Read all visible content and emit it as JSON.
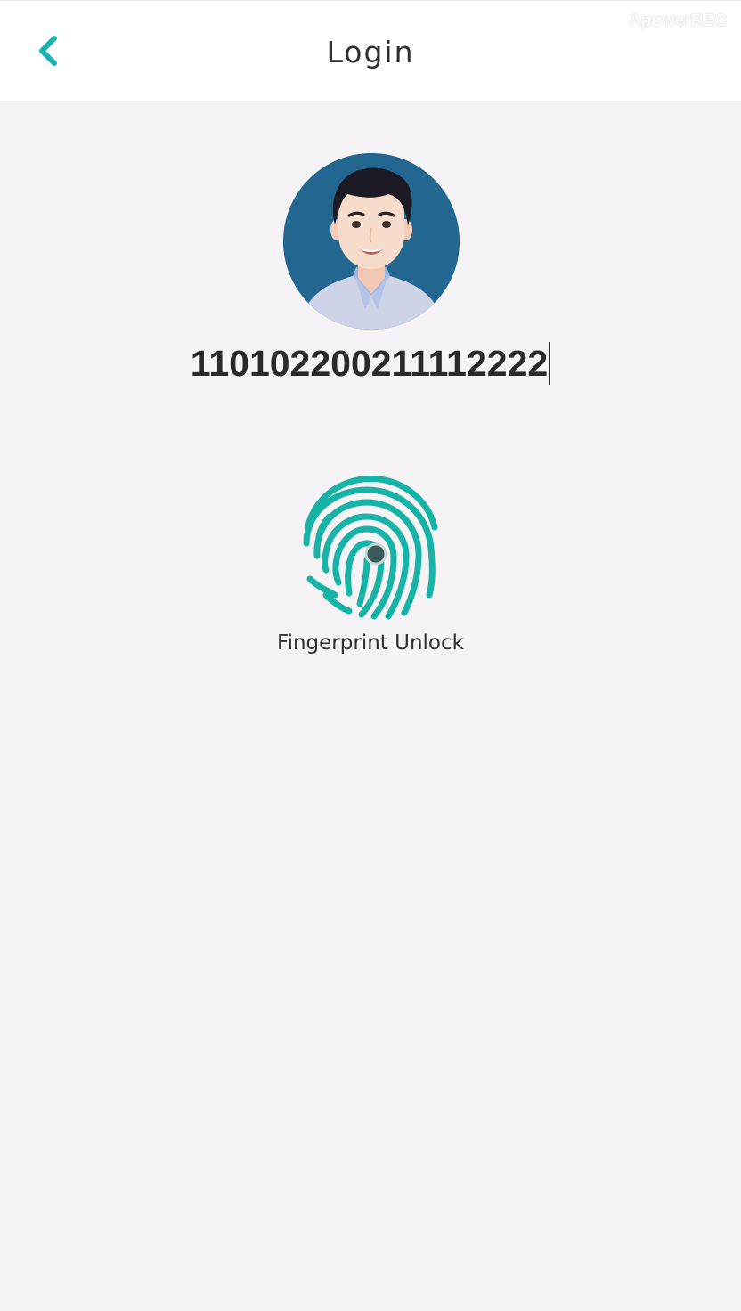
{
  "header": {
    "title": "Login",
    "back_icon": "chevron-left-icon",
    "accent_color": "#17b3b0"
  },
  "watermark": "ApowerREC",
  "profile": {
    "avatar": "user-avatar",
    "account_number": "110102200211112222"
  },
  "fingerprint": {
    "icon": "fingerprint-icon",
    "label": "Fingerprint Unlock",
    "color": "#17b3a6"
  },
  "colors": {
    "background": "#f5f3f5",
    "header_background": "#ffffff"
  }
}
